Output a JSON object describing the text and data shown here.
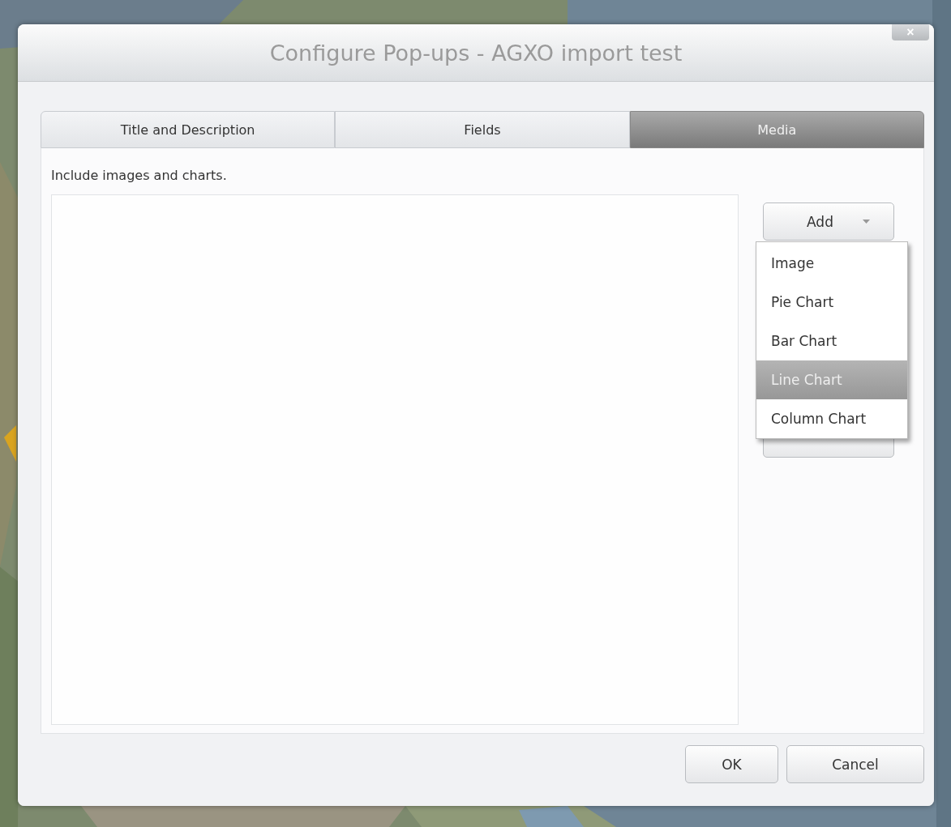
{
  "window": {
    "title": "Configure Pop-ups - AGXO import test",
    "close_button": "×"
  },
  "tabs": [
    {
      "label": "Title and Description",
      "selected": false
    },
    {
      "label": "Fields",
      "selected": false
    },
    {
      "label": "Media",
      "selected": true
    }
  ],
  "instructions": "Include images and charts.",
  "add_button": {
    "label": "Add",
    "expanded": true
  },
  "add_menu": [
    {
      "label": "Image",
      "selected": false
    },
    {
      "label": "Pie Chart",
      "selected": false
    },
    {
      "label": "Bar Chart",
      "selected": false
    },
    {
      "label": "Line Chart",
      "selected": true
    },
    {
      "label": "Column Chart",
      "selected": false
    }
  ],
  "buttons": [
    "OK",
    "Cancel"
  ]
}
